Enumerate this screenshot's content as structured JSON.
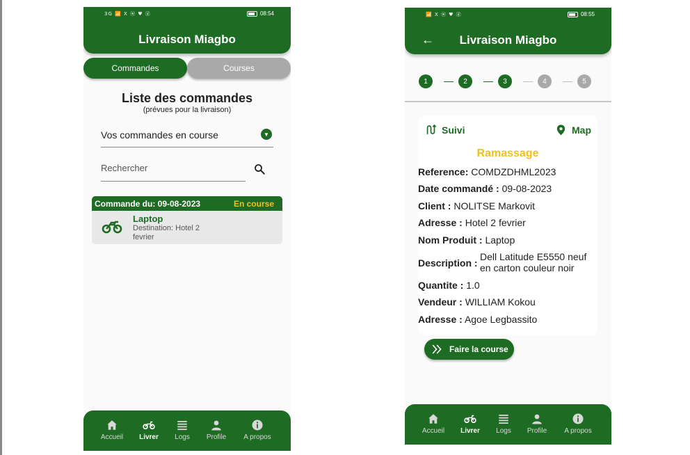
{
  "colors": {
    "primary": "#1e6b24",
    "accent": "#f0c020",
    "inactive": "#a9a9a9"
  },
  "screen1": {
    "status_time": "08:54",
    "status_icons": "3G 📶 X ⓦ ♥ ⓓ",
    "title": "Livraison Miagbo",
    "tabs": [
      {
        "label": "Commandes",
        "active": true
      },
      {
        "label": "Courses",
        "active": false
      }
    ],
    "list_title": "Liste des commandes",
    "list_subtitle": "(prévues pour la livraison)",
    "filter_selected": "Vos commandes en course",
    "search_placeholder": "Rechercher",
    "order": {
      "header_date": "Commande du: 09-08-2023",
      "status": "En course",
      "product": "Laptop",
      "destination": "Destination: Hotel 2 fevrier"
    },
    "nav": [
      {
        "label": "Accueil",
        "icon": "home-icon",
        "active": false
      },
      {
        "label": "Livrer",
        "icon": "motorcycle-icon",
        "active": true
      },
      {
        "label": "Logs",
        "icon": "list-icon",
        "active": false
      },
      {
        "label": "Profile",
        "icon": "person-icon",
        "active": false
      },
      {
        "label": "A propos",
        "icon": "info-icon",
        "active": false
      }
    ]
  },
  "screen2": {
    "status_time": "08:55",
    "status_icons": "📶 X ⓦ ♥ ⓓ",
    "title": "Livraison Miagbo",
    "steps": [
      {
        "label": "1",
        "done": true
      },
      {
        "label": "2",
        "done": true
      },
      {
        "label": "3",
        "done": true
      },
      {
        "label": "4",
        "done": false
      },
      {
        "label": "5",
        "done": false
      }
    ],
    "links": {
      "track": "Suivi",
      "map": "Map"
    },
    "phase": "Ramassage",
    "fields": {
      "reference_label": "Reference:",
      "reference": "COMDZDHML2023",
      "date_label": "Date commandé :",
      "date": "09-08-2023",
      "client_label": "Client :",
      "client": "NOLITSE Markovit",
      "address_label": "Adresse :",
      "address": "Hotel 2 fevrier",
      "product_label": "Nom Produit :",
      "product": "Laptop",
      "description_label": "Description :",
      "description": "Dell Latitude E5550 neuf en carton couleur noir",
      "quantity_label": "Quantite :",
      "quantity": "1.0",
      "seller_label": "Vendeur :",
      "seller": "WILLIAM Kokou",
      "seller_address_label": "Adresse :",
      "seller_address": "Agoe Legbassito"
    },
    "action_label": "Faire la course",
    "nav": [
      {
        "label": "Accueil",
        "icon": "home-icon",
        "active": false
      },
      {
        "label": "Livrer",
        "icon": "motorcycle-icon",
        "active": true
      },
      {
        "label": "Logs",
        "icon": "list-icon",
        "active": false
      },
      {
        "label": "Profile",
        "icon": "person-icon",
        "active": false
      },
      {
        "label": "A propos",
        "icon": "info-icon",
        "active": false
      }
    ]
  }
}
